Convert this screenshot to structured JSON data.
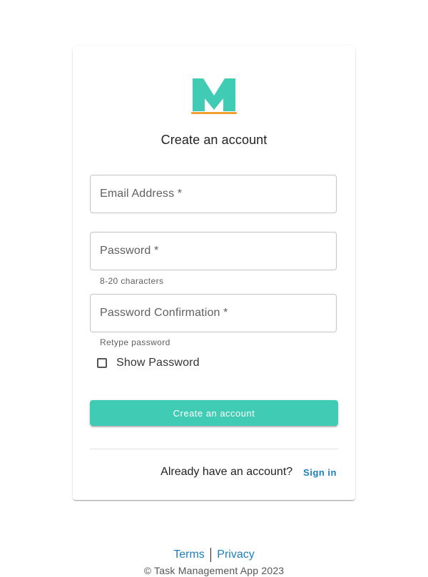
{
  "brand": {
    "logo_icon": "m-logo-icon",
    "logo_color": "#40ccb4",
    "logo_underline_color": "#f0a030"
  },
  "form": {
    "title": "Create an account",
    "email": {
      "label": "Email Address *",
      "value": ""
    },
    "password": {
      "label": "Password *",
      "value": "",
      "helper": "8-20 characters"
    },
    "password_confirmation": {
      "label": "Password Confirmation *",
      "value": "",
      "helper": "Retype password"
    },
    "show_password": {
      "label": "Show Password",
      "checked": false
    },
    "submit_label": "Create an account",
    "signin_prompt": "Already have an account?",
    "signin_link": "Sign in"
  },
  "colors": {
    "accent": "#40ccb4",
    "link": "#1a7fbf"
  },
  "footer": {
    "terms": "Terms",
    "privacy": "Privacy",
    "copyright": "© Task Management App 2023"
  }
}
